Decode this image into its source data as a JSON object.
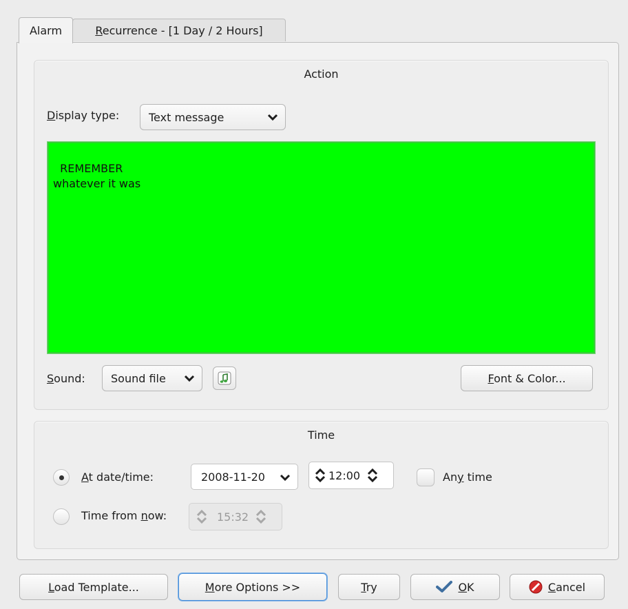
{
  "tabs": [
    {
      "label": "Alarm"
    },
    {
      "label_prefix": "",
      "mnemonic": "R",
      "label_rest": "ecurrence - [1 Day / 2 Hours]"
    }
  ],
  "action": {
    "title": "Action",
    "display_type_label_mn": "D",
    "display_type_label_rest": "isplay type:",
    "display_type_value": "Text message",
    "message_lines": "REMEMBER\nwhatever it was",
    "message_bg": "#00ff00",
    "sound_label_mn": "S",
    "sound_label_rest": "ound:",
    "sound_value": "Sound file",
    "sound_file_icon": "music-note-icon",
    "font_color_mn": "F",
    "font_color_rest": "ont & Color..."
  },
  "time": {
    "title": "Time",
    "at_datetime_mn": "A",
    "at_datetime_rest": "t date/time:",
    "at_datetime_selected": true,
    "date_value": "2008-11-20",
    "time_value": "12:00",
    "any_time_pre": "An",
    "any_time_mn": "y",
    "any_time_rest": " time",
    "any_time_checked": false,
    "time_from_pre": "Time from ",
    "time_from_mn": "n",
    "time_from_rest": "ow:",
    "time_from_selected": false,
    "time_from_value": "15:32"
  },
  "buttons": {
    "load_template_mn": "L",
    "load_template_rest": "oad Template...",
    "more_options_mn": "M",
    "more_options_rest": "ore Options >>",
    "try_mn": "T",
    "try_rest": "ry",
    "ok_mn": "O",
    "ok_rest": "K",
    "cancel_mn": "C",
    "cancel_rest": "ancel"
  }
}
